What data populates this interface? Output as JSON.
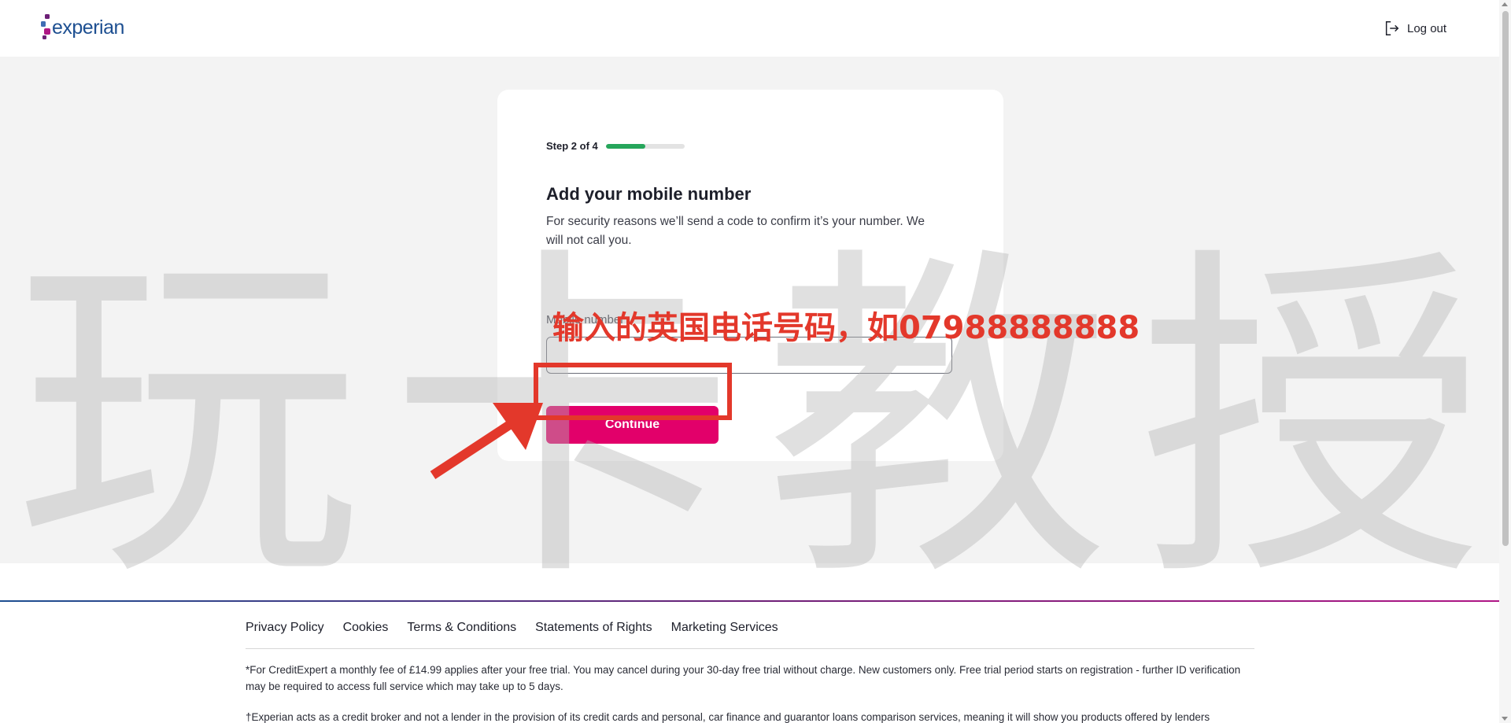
{
  "header": {
    "logo_text": "experian",
    "logout_label": "Log out"
  },
  "form": {
    "step_label": "Step 2 of 4",
    "progress_fraction": 0.5,
    "title": "Add your mobile number",
    "subtitle": "For security reasons we’ll send a code to confirm it’s your number. We will not call you.",
    "mobile_label": "Mobile number",
    "mobile_value": "",
    "continue_label": "Continue"
  },
  "footer": {
    "links": [
      "Privacy Policy",
      "Cookies",
      "Terms & Conditions",
      "Statements of Rights",
      "Marketing Services"
    ],
    "text1": "*For CreditExpert a monthly fee of £14.99 applies after your free trial. You may cancel during your 30-day free trial without charge. New customers only. Free trial period starts on registration - further ID verification may be required to access full service which may take up to 5 days.",
    "text2": "†Experian acts as a credit broker and not a lender in the provision of its credit cards and personal, car finance and guarantor loans comparison services, meaning it will show you products offered by lenders"
  },
  "overlay": {
    "watermark_chars": [
      "玩",
      "卡",
      "教",
      "授"
    ],
    "annotation_text": "输入的英国电话号码，如07988888888",
    "annotation_color": "#e3382b"
  },
  "colors": {
    "accent": "#e2006a",
    "progress": "#26a65b",
    "brand_blue": "#1d4f91"
  }
}
